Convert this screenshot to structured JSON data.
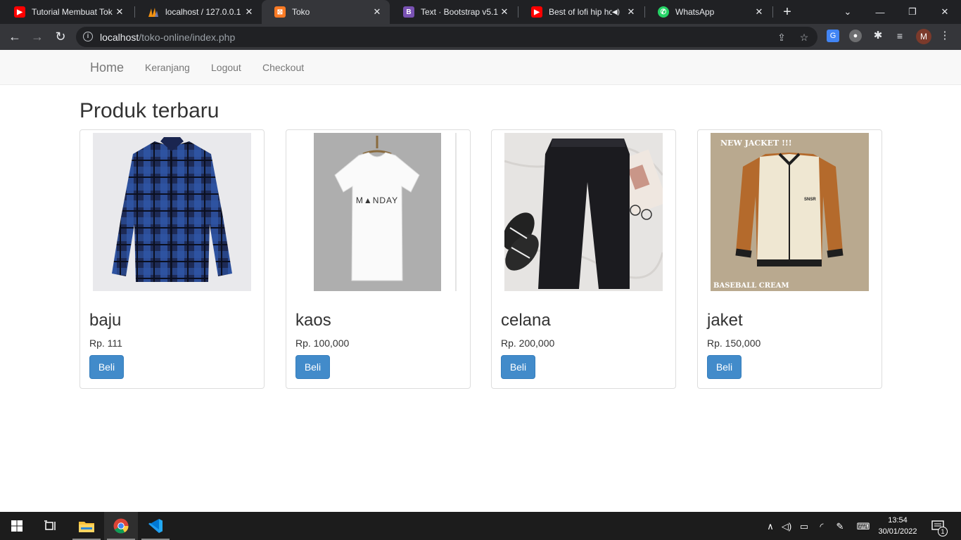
{
  "browser": {
    "tabs": [
      {
        "title": "Tutorial Membuat Tok",
        "favicon": "youtube-icon",
        "color": "#ff0000"
      },
      {
        "title": "localhost / 127.0.0.1 /",
        "favicon": "phpmyadmin-icon",
        "color": "#f29111"
      },
      {
        "title": "Toko",
        "favicon": "xampp-icon",
        "color": "#fb7a24",
        "active": true
      },
      {
        "title": "Text · Bootstrap v5.1",
        "favicon": "bootstrap-icon",
        "color": "#7952b3"
      },
      {
        "title": "Best of lofi hip ho",
        "favicon": "youtube-icon",
        "color": "#ff0000",
        "audio": true
      },
      {
        "title": "WhatsApp",
        "favicon": "whatsapp-icon",
        "color": "#25d366"
      }
    ],
    "address": {
      "host": "localhost",
      "path": "/toko-online/index.php"
    },
    "profile_initial": "M"
  },
  "navbar": {
    "brand": "Home",
    "links": [
      "Keranjang",
      "Logout",
      "Checkout"
    ]
  },
  "main": {
    "title": "Produk terbaru",
    "buy_label": "Beli",
    "products": [
      {
        "name": "baju",
        "price": "Rp. 111",
        "image": "plaid-shirt-image"
      },
      {
        "name": "kaos",
        "price": "Rp. 100,000",
        "image": "white-tshirt-image",
        "print": "M▲NDAY"
      },
      {
        "name": "celana",
        "price": "Rp. 200,000",
        "image": "black-pants-image"
      },
      {
        "name": "jaket",
        "price": "Rp. 150,000",
        "image": "baseball-jacket-image",
        "caption_top": "NEW JACKET !!!",
        "caption_bottom": "BASEBALL CREAM",
        "badge": "SNSR"
      }
    ]
  },
  "taskbar": {
    "time": "13:54",
    "date": "30/01/2022",
    "notifications": "1"
  }
}
